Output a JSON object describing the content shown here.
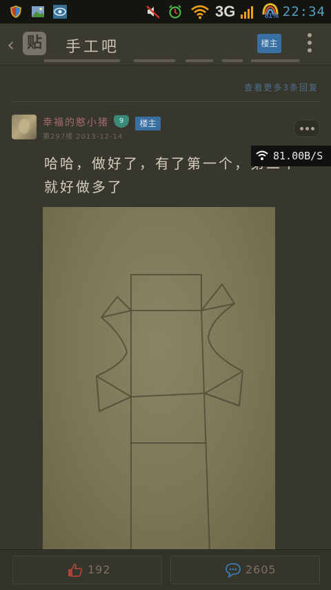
{
  "status_bar": {
    "network": "3G",
    "battery": "81%",
    "time": "22:34",
    "net_speed": "81.00B/S"
  },
  "nav": {
    "logo": "贴",
    "title": "手工吧",
    "owner_button": "楼主"
  },
  "previous_post": {
    "reply_link": "查看更多3条回复"
  },
  "post": {
    "username": "幸福的憨小猪",
    "level": "9",
    "owner_badge": "楼主",
    "floor_meta": "第297楼 2013-12-14",
    "body": "哈哈，做好了，有了第一个，第二个就好做多了"
  },
  "bottom_bar": {
    "like_count": "192",
    "comment_count": "2605"
  },
  "colors": {
    "accent_blue": "#3a6fa2",
    "level_teal": "#3a8a7a",
    "time_blue": "#4fa0c4"
  }
}
